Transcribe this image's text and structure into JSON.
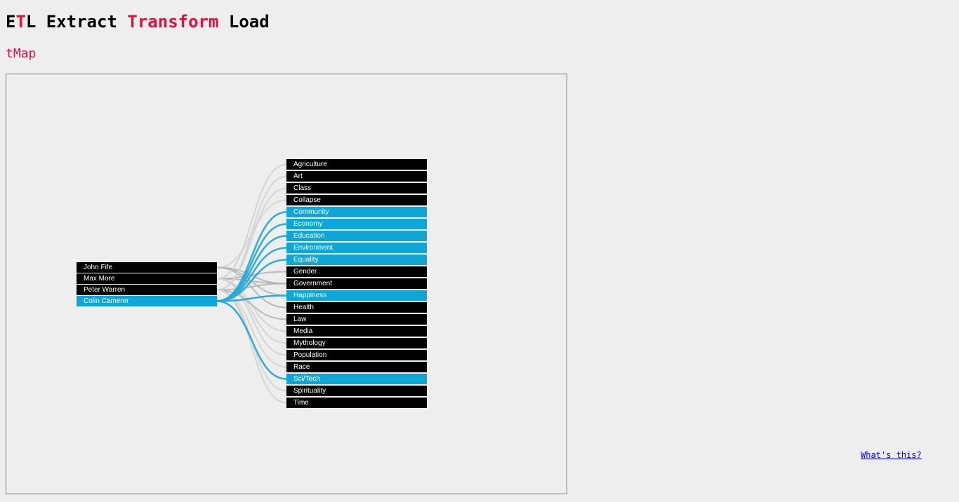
{
  "header": {
    "title_parts": [
      {
        "text": "E",
        "color": "#000000"
      },
      {
        "text": "T",
        "color": "#dc143c"
      },
      {
        "text": "L Extract ",
        "color": "#000000"
      },
      {
        "text": "Transform",
        "color": "#dc143c"
      },
      {
        "text": " Load",
        "color": "#000000"
      }
    ],
    "subtitle": "tMap"
  },
  "colors": {
    "accent": "#dc143c",
    "node_bg": "#000000",
    "node_active_bg": "#0ea6d6",
    "link_active": "#23a9d8",
    "link_inactive": "#b4b4b4",
    "link_faint": "#d2d2d2"
  },
  "sources": [
    {
      "label": "John Fife",
      "active": false
    },
    {
      "label": "Max More",
      "active": false
    },
    {
      "label": "Peter Warren",
      "active": false
    },
    {
      "label": "Colin Camerer",
      "active": true
    }
  ],
  "targets": [
    {
      "label": "Agriculture",
      "active": false
    },
    {
      "label": "Art",
      "active": false
    },
    {
      "label": "Class",
      "active": false
    },
    {
      "label": "Collapse",
      "active": false
    },
    {
      "label": "Community",
      "active": true
    },
    {
      "label": "Economy",
      "active": true
    },
    {
      "label": "Education",
      "active": true
    },
    {
      "label": "Environment",
      "active": true
    },
    {
      "label": "Equality",
      "active": true
    },
    {
      "label": "Gender",
      "active": false
    },
    {
      "label": "Government",
      "active": false
    },
    {
      "label": "Happiness",
      "active": true
    },
    {
      "label": "Health",
      "active": false
    },
    {
      "label": "Law",
      "active": false
    },
    {
      "label": "Media",
      "active": false
    },
    {
      "label": "Mythology",
      "active": false
    },
    {
      "label": "Population",
      "active": false
    },
    {
      "label": "Race",
      "active": false
    },
    {
      "label": "Sci/Tech",
      "active": true
    },
    {
      "label": "Spirituality",
      "active": false
    },
    {
      "label": "Time",
      "active": false
    }
  ],
  "links": [
    {
      "source": "John Fife",
      "target": "Government"
    },
    {
      "source": "John Fife",
      "target": "Happiness"
    },
    {
      "source": "John Fife",
      "target": "Collapse"
    },
    {
      "source": "John Fife",
      "target": "Health"
    },
    {
      "source": "Max More",
      "target": "Agriculture"
    },
    {
      "source": "Max More",
      "target": "Gender"
    },
    {
      "source": "Max More",
      "target": "Government"
    },
    {
      "source": "Max More",
      "target": "Media"
    },
    {
      "source": "Max More",
      "target": "Mythology"
    },
    {
      "source": "Max More",
      "target": "Population"
    },
    {
      "source": "Peter Warren",
      "target": "Art"
    },
    {
      "source": "Peter Warren",
      "target": "Class"
    },
    {
      "source": "Peter Warren",
      "target": "Government"
    },
    {
      "source": "Peter Warren",
      "target": "Law"
    },
    {
      "source": "Peter Warren",
      "target": "Race"
    },
    {
      "source": "Peter Warren",
      "target": "Spirituality"
    },
    {
      "source": "Peter Warren",
      "target": "Time"
    },
    {
      "source": "Colin Camerer",
      "target": "Community"
    },
    {
      "source": "Colin Camerer",
      "target": "Economy"
    },
    {
      "source": "Colin Camerer",
      "target": "Education"
    },
    {
      "source": "Colin Camerer",
      "target": "Environment"
    },
    {
      "source": "Colin Camerer",
      "target": "Equality"
    },
    {
      "source": "Colin Camerer",
      "target": "Happiness"
    },
    {
      "source": "Colin Camerer",
      "target": "Sci/Tech"
    }
  ],
  "footer": {
    "help_link": "What's this?"
  }
}
